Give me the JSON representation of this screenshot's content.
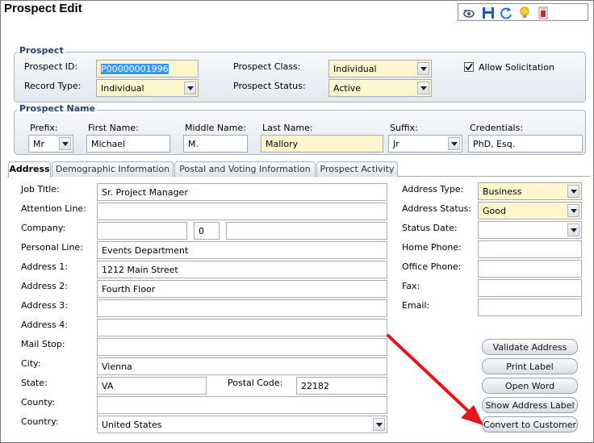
{
  "title": "Prospect Edit",
  "toolbar": {
    "icons": [
      "view-icon",
      "save-icon",
      "refresh-icon",
      "lightbulb-icon",
      "report-icon"
    ]
  },
  "prospect": {
    "group_title": "Prospect",
    "id_label": "Prospect ID:",
    "id_value": "P00000001996",
    "class_label": "Prospect Class:",
    "class_value": "Individual",
    "allow_solicitation_label": "Allow Solicitation",
    "allow_solicitation_checked": true,
    "record_type_label": "Record Type:",
    "record_type_value": "Individual",
    "status_label": "Prospect Status:",
    "status_value": "Active"
  },
  "name": {
    "group_title": "Prospect Name",
    "prefix_label": "Prefix:",
    "prefix_value": "Mr",
    "first_label": "First Name:",
    "first_value": "Michael",
    "middle_label": "Middle Name:",
    "middle_value": "M.",
    "last_label": "Last Name:",
    "last_value": "Mallory",
    "suffix_label": "Suffix:",
    "suffix_value": "Jr",
    "credentials_label": "Credentials:",
    "credentials_value": "PhD, Esq."
  },
  "tabs": [
    {
      "label": "Address",
      "active": true
    },
    {
      "label": "Demographic Information",
      "active": false
    },
    {
      "label": "Postal and Voting Information",
      "active": false
    },
    {
      "label": "Prospect Activity",
      "active": false
    }
  ],
  "address": {
    "job_title_label": "Job Title:",
    "job_title_value": "Sr. Project Manager",
    "attention_label": "Attention Line:",
    "attention_value": "",
    "company_label": "Company:",
    "company_value": "",
    "company_num": "0",
    "company_extra": "",
    "personal_label": "Personal Line:",
    "personal_value": "Events Department",
    "address1_label": "Address 1:",
    "address1_value": "1212 Main Street",
    "address2_label": "Address 2:",
    "address2_value": "Fourth Floor",
    "address3_label": "Address 3:",
    "address3_value": "",
    "address4_label": "Address 4:",
    "address4_value": "",
    "mailstop_label": "Mail Stop:",
    "mailstop_value": "",
    "city_label": "City:",
    "city_value": "Vienna",
    "state_label": "State:",
    "state_value": "VA",
    "postal_label": "Postal Code:",
    "postal_value": "22182",
    "county_label": "County:",
    "county_value": "",
    "country_label": "Country:",
    "country_value": "United States",
    "type_label": "Address Type:",
    "type_value": "Business",
    "addr_status_label": "Address Status:",
    "addr_status_value": "Good",
    "status_date_label": "Status Date:",
    "status_date_value": "",
    "home_phone_label": "Home Phone:",
    "home_phone_value": "",
    "office_phone_label": "Office Phone:",
    "office_phone_value": "",
    "fax_label": "Fax:",
    "fax_value": "",
    "email_label": "Email:",
    "email_value": ""
  },
  "buttons": {
    "validate": "Validate Address",
    "print": "Print Label",
    "open_word": "Open Word",
    "show_label": "Show Address Label",
    "convert": "Convert to Customer"
  },
  "colors": {
    "required_bg": "#fff6cf",
    "arrow": "#e8141a",
    "group_title": "#22446a"
  }
}
